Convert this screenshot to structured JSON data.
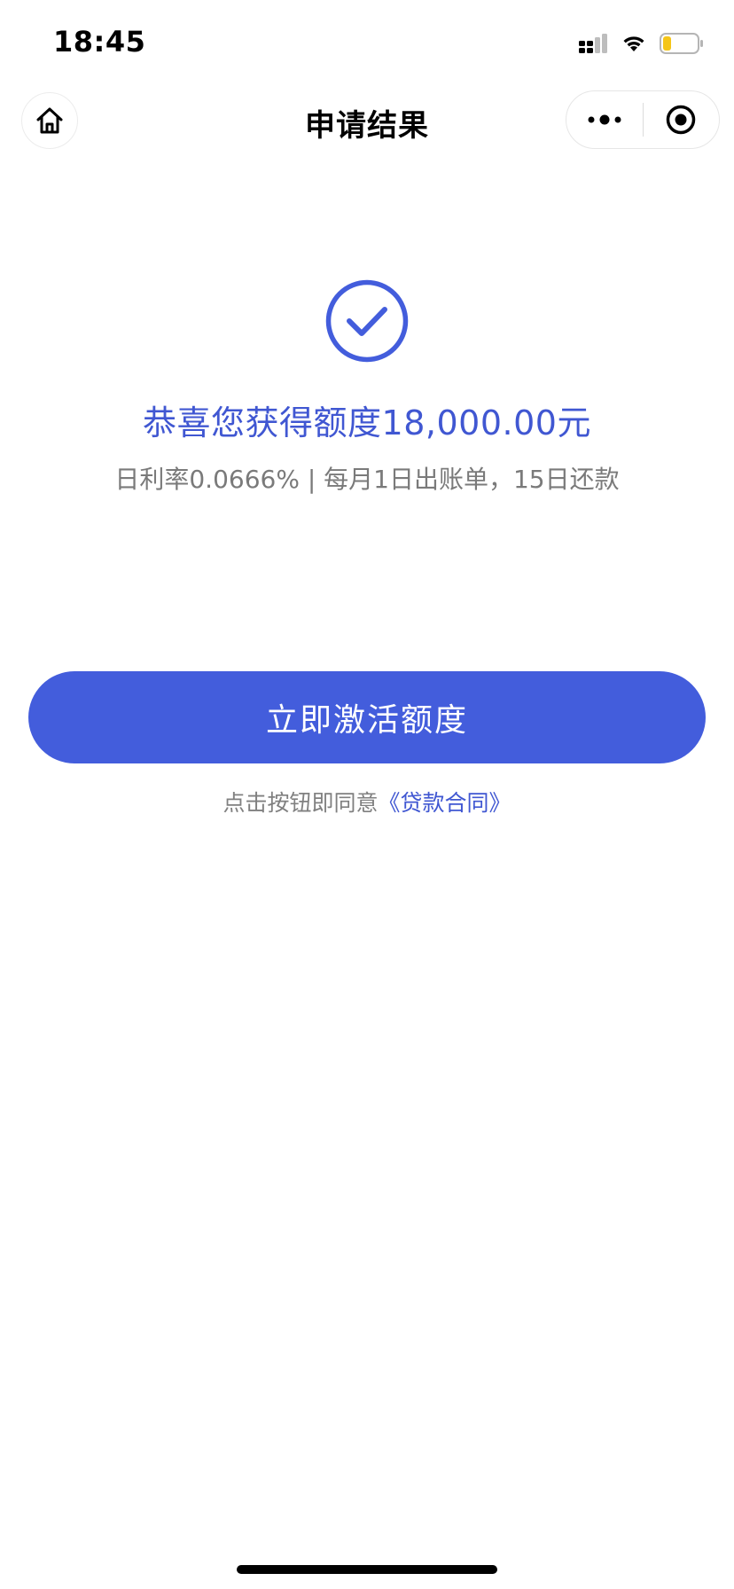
{
  "status_bar": {
    "time": "18:45",
    "icons": [
      "cellular-signal-icon",
      "wifi-icon",
      "battery-low-icon"
    ]
  },
  "nav": {
    "title": "申请结果",
    "icons": [
      "home-icon",
      "more-dots-icon",
      "target-circle-icon"
    ]
  },
  "result": {
    "icon": "check-circle-icon",
    "title": "恭喜您获得额度18,000.00元",
    "subtitle": "日利率0.0666% | 每月1日出账单，15日还款"
  },
  "cta": {
    "label": "立即激活额度"
  },
  "agreement": {
    "prefix": "点击按钮即同意",
    "link_text": "《贷款合同》"
  },
  "colors": {
    "accent": "#435ddc",
    "accent_text": "#4057d2",
    "muted_text": "#7a7a7a",
    "battery_low": "#f5c518"
  }
}
